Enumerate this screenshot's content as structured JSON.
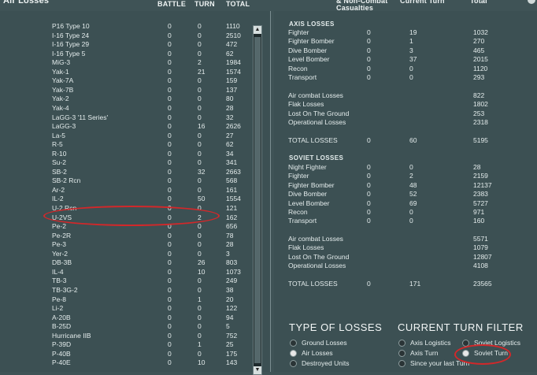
{
  "header": {
    "title": "Air Losses",
    "battle": "BATTLE",
    "turn": "TURN",
    "total": "TOTAL",
    "noncombat_line1": "& Non-Combat",
    "noncombat_line2": "Casualties",
    "current_turn": "Current Turn",
    "total_right": "Total"
  },
  "aircraft": [
    [
      "P16 Type 10",
      "0",
      "0",
      "1110"
    ],
    [
      "I-16 Type 24",
      "0",
      "0",
      "2510"
    ],
    [
      "I-16 Type 29",
      "0",
      "0",
      "472"
    ],
    [
      "I-16 Type 5",
      "0",
      "0",
      "62"
    ],
    [
      "MiG-3",
      "0",
      "2",
      "1984"
    ],
    [
      "Yak-1",
      "0",
      "21",
      "1574"
    ],
    [
      "Yak-7A",
      "0",
      "0",
      "159"
    ],
    [
      "Yak-7B",
      "0",
      "0",
      "137"
    ],
    [
      "Yak-2",
      "0",
      "0",
      "80"
    ],
    [
      "Yak-4",
      "0",
      "0",
      "28"
    ],
    [
      "LaGG-3 '11 Series'",
      "0",
      "0",
      "32"
    ],
    [
      "LaGG-3",
      "0",
      "16",
      "2626"
    ],
    [
      "La-5",
      "0",
      "0",
      "27"
    ],
    [
      "R-5",
      "0",
      "0",
      "62"
    ],
    [
      "R-10",
      "0",
      "0",
      "34"
    ],
    [
      "Su-2",
      "0",
      "0",
      "341"
    ],
    [
      "SB-2",
      "0",
      "32",
      "2663"
    ],
    [
      "SB-2 Rcn",
      "0",
      "0",
      "568"
    ],
    [
      "Ar-2",
      "0",
      "0",
      "161"
    ],
    [
      "IL-2",
      "0",
      "50",
      "1554"
    ],
    [
      "U-2 Rcn",
      "0",
      "0",
      "121"
    ],
    [
      "U-2VS",
      "0",
      "2",
      "162"
    ],
    [
      "Pe-2",
      "0",
      "0",
      "656"
    ],
    [
      "Pe-2R",
      "0",
      "0",
      "78"
    ],
    [
      "Pe-3",
      "0",
      "0",
      "28"
    ],
    [
      "Yer-2",
      "0",
      "0",
      "3"
    ],
    [
      "DB-3B",
      "0",
      "26",
      "803"
    ],
    [
      "IL-4",
      "0",
      "10",
      "1073"
    ],
    [
      "TB-3",
      "0",
      "0",
      "249"
    ],
    [
      "TB-3G-2",
      "0",
      "0",
      "38"
    ],
    [
      "Pe-8",
      "0",
      "1",
      "20"
    ],
    [
      "Li-2",
      "0",
      "0",
      "122"
    ],
    [
      "A-20B",
      "0",
      "0",
      "94"
    ],
    [
      "B-25D",
      "0",
      "0",
      "5"
    ],
    [
      "Hurricane IIB",
      "0",
      "0",
      "752"
    ],
    [
      "P-39D",
      "0",
      "1",
      "25"
    ],
    [
      "P-40B",
      "0",
      "0",
      "175"
    ],
    [
      "P-40E",
      "0",
      "10",
      "143"
    ]
  ],
  "axis": {
    "title": "AXIS LOSSES",
    "rows": [
      [
        "Fighter",
        "0",
        "19",
        "1032"
      ],
      [
        "Fighter Bomber",
        "0",
        "1",
        "270"
      ],
      [
        "Dive Bomber",
        "0",
        "3",
        "465"
      ],
      [
        "Level Bomber",
        "0",
        "37",
        "2015"
      ],
      [
        "Recon",
        "0",
        "0",
        "1120"
      ],
      [
        "Transport",
        "0",
        "0",
        "293"
      ]
    ],
    "summary": [
      [
        "Air combat Losses",
        "822"
      ],
      [
        "Flak Losses",
        "1802"
      ],
      [
        "Lost On The Ground",
        "253"
      ],
      [
        "Operational Losses",
        "2318"
      ]
    ],
    "total": [
      "TOTAL LOSSES",
      "0",
      "60",
      "5195"
    ]
  },
  "soviet": {
    "title": "SOVIET LOSSES",
    "rows": [
      [
        "Night Fighter",
        "0",
        "0",
        "28"
      ],
      [
        "Fighter",
        "0",
        "2",
        "2159"
      ],
      [
        "Fighter Bomber",
        "0",
        "48",
        "12137"
      ],
      [
        "Dive Bomber",
        "0",
        "52",
        "2383"
      ],
      [
        "Level Bomber",
        "0",
        "69",
        "5727"
      ],
      [
        "Recon",
        "0",
        "0",
        "971"
      ],
      [
        "Transport",
        "0",
        "0",
        "160"
      ]
    ],
    "summary": [
      [
        "Air combat Losses",
        "5571"
      ],
      [
        "Flak Losses",
        "1079"
      ],
      [
        "Lost On The Ground",
        "12807"
      ],
      [
        "Operational Losses",
        "4108"
      ]
    ],
    "total": [
      "TOTAL LOSSES",
      "0",
      "171",
      "23565"
    ]
  },
  "type_of_losses": {
    "title": "TYPE OF LOSSES",
    "options": [
      "Ground Losses",
      "Air Losses",
      "Destroyed Units"
    ],
    "selected": "Air Losses"
  },
  "turn_filter": {
    "title": "CURRENT TURN FILTER",
    "axis_logistics": "Axis Logistics",
    "soviet_logistics": "Soviet Logistics",
    "axis_turn": "Axis Turn",
    "soviet_turn": "Soviet Turn",
    "since_last": "Since your last Turn",
    "selected": "Soviet Turn"
  },
  "colors": {
    "highlight": "#d2282a",
    "background": "#3c5053"
  }
}
